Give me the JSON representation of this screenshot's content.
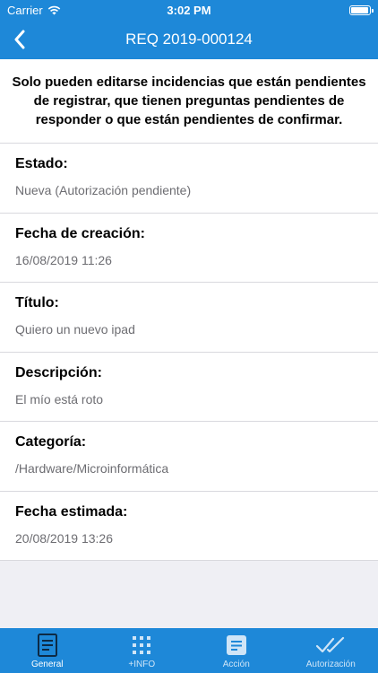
{
  "status_bar": {
    "carrier": "Carrier",
    "time": "3:02 PM"
  },
  "nav": {
    "title": "REQ 2019-000124",
    "back_icon": "chevron-left-icon"
  },
  "notice": "Solo pueden editarse incidencias que están pendientes de registrar, que tienen preguntas pendientes de responder o que están pendientes de confirmar.",
  "fields": [
    {
      "label": "Estado:",
      "value": "Nueva (Autorización pendiente)"
    },
    {
      "label": "Fecha de creación:",
      "value": "16/08/2019 11:26"
    },
    {
      "label": "Título:",
      "value": "Quiero un nuevo ipad"
    },
    {
      "label": "Descripción:",
      "value": "El mío está roto"
    },
    {
      "label": "Categoría:",
      "value": "/Hardware/Microinformática"
    },
    {
      "label": "Fecha estimada:",
      "value": "20/08/2019 13:26"
    }
  ],
  "tabs": [
    {
      "label": "General",
      "icon": "document-icon",
      "active": true
    },
    {
      "label": "+INFO",
      "icon": "grid-icon",
      "active": false
    },
    {
      "label": "Acción",
      "icon": "note-icon",
      "active": false
    },
    {
      "label": "Autorización",
      "icon": "double-check-icon",
      "active": false
    }
  ],
  "colors": {
    "primary": "#1e88d8",
    "background": "#efeff4",
    "secondary_text": "#6d6d72"
  }
}
